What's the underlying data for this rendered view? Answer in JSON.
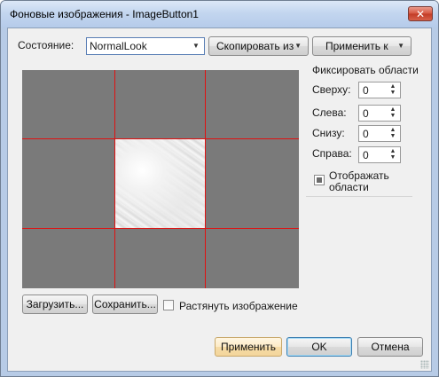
{
  "window": {
    "title": "Фоновые изображения - ImageButton1",
    "close_glyph": "✕"
  },
  "toolbar": {
    "state_label": "Состояние:",
    "state_value": "NormalLook",
    "copy_from_label": "Скопировать из",
    "apply_to_label": "Применить к",
    "dropdown_glyph": "▼"
  },
  "fix_areas": {
    "heading": "Фиксировать области",
    "fields": [
      {
        "label": "Сверху:",
        "value": "0"
      },
      {
        "label": "Слева:",
        "value": "0"
      },
      {
        "label": "Снизу:",
        "value": "0"
      },
      {
        "label": "Справа:",
        "value": "0"
      }
    ],
    "show_areas_label": "Отображать\nобласти",
    "show_areas_line1": "Отображать",
    "show_areas_line2": "области",
    "show_areas_state": "indeterminate",
    "spin_glyph": "▲\n▼"
  },
  "preview": {
    "guide_color": "#e01010",
    "background_color": "#7a7a7a",
    "image": "marble-texture"
  },
  "bottom_actions": {
    "load_label": "Загрузить...",
    "save_label": "Сохранить...",
    "stretch_label": "Растянуть изображение",
    "stretch_checked": false
  },
  "dialog_buttons": {
    "apply_label": "Применить",
    "ok_label": "OK",
    "cancel_label": "Отмена"
  }
}
